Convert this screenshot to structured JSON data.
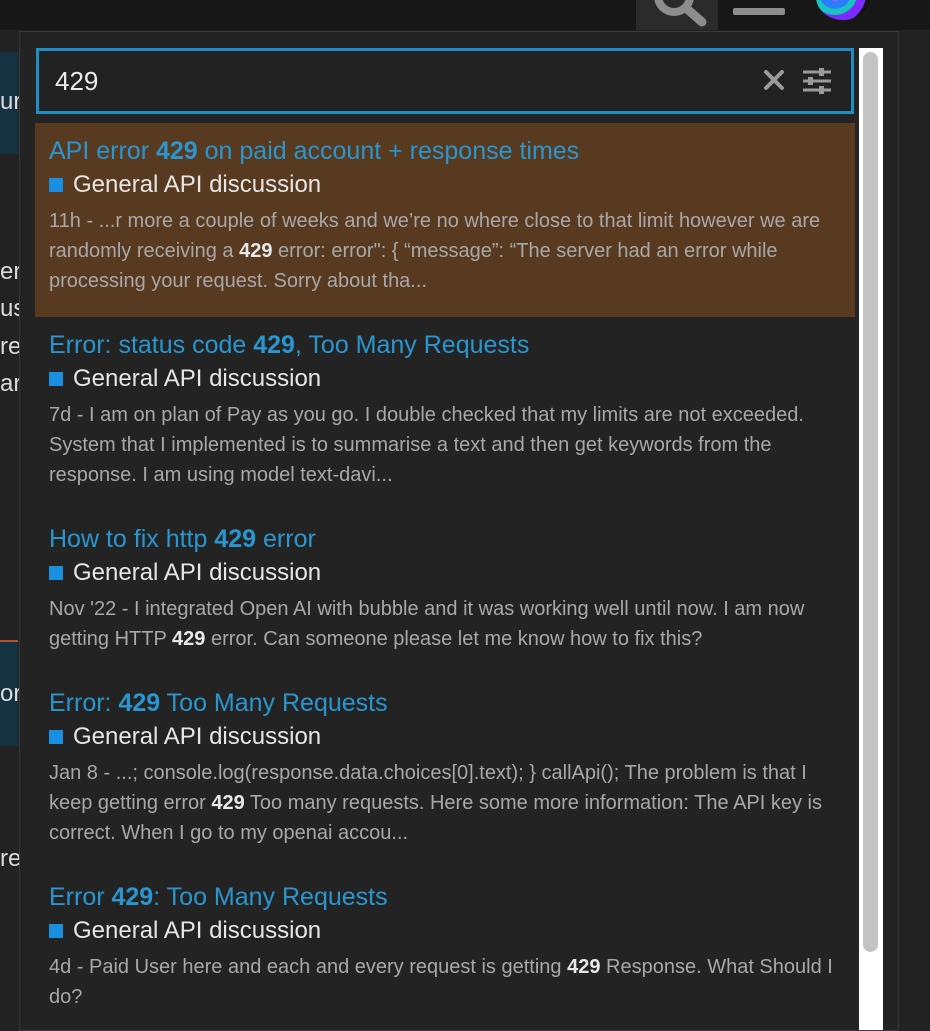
{
  "search": {
    "query": "429"
  },
  "highlight_term": "429",
  "category_color": "#1a8fe0",
  "results": [
    {
      "title_pre": "API error ",
      "title_hl": "429",
      "title_post": " on paid account + response times",
      "category": "General API discussion",
      "date": "11h",
      "blurb_pre": " - ...r more a couple of weeks and we’re no where close to that limit however we are randomly receiving a ",
      "blurb_hl": "429",
      "blurb_post": " error: error\": { “message”: “The server had an error while processing your request. Sorry about tha...",
      "active": true
    },
    {
      "title_pre": "Error: status code ",
      "title_hl": "429",
      "title_post": ", Too Many Requests",
      "category": "General API discussion",
      "date": "7d",
      "blurb_pre": " - I am on plan of Pay as you go. I double checked that my limits are not exceeded. System that I implemented is to summarise a text and then get keywords from the response. I am using model text-davi...",
      "blurb_hl": "",
      "blurb_post": "",
      "active": false
    },
    {
      "title_pre": "How to fix http ",
      "title_hl": "429",
      "title_post": " error",
      "category": "General API discussion",
      "date": "Nov '22",
      "blurb_pre": " - I integrated Open AI with bubble and it was working well until now. I am now getting HTTP ",
      "blurb_hl": "429",
      "blurb_post": " error. Can someone please let me know how to fix this?",
      "active": false
    },
    {
      "title_pre": "Error: ",
      "title_hl": "429",
      "title_post": " Too Many Requests",
      "category": "General API discussion",
      "date": "Jan 8",
      "blurb_pre": " - ...; console.log(response.data.choices[0].text); } callApi(); The problem is that I keep getting error ",
      "blurb_hl": "429",
      "blurb_post": " Too many requests. Here some more information: The API key is correct. When I go to my openai accou...",
      "active": false
    },
    {
      "title_pre": "Error ",
      "title_hl": "429",
      "title_post": ": Too Many Requests",
      "category": "General API discussion",
      "date": "4d",
      "blurb_pre": " - Paid User here and each and every request is getting ",
      "blurb_hl": "429",
      "blurb_post": " Response. What Should I do?",
      "active": false
    }
  ],
  "background_fragments": [
    "ur",
    "er",
    "us",
    "re",
    "ar",
    "or",
    "re"
  ]
}
